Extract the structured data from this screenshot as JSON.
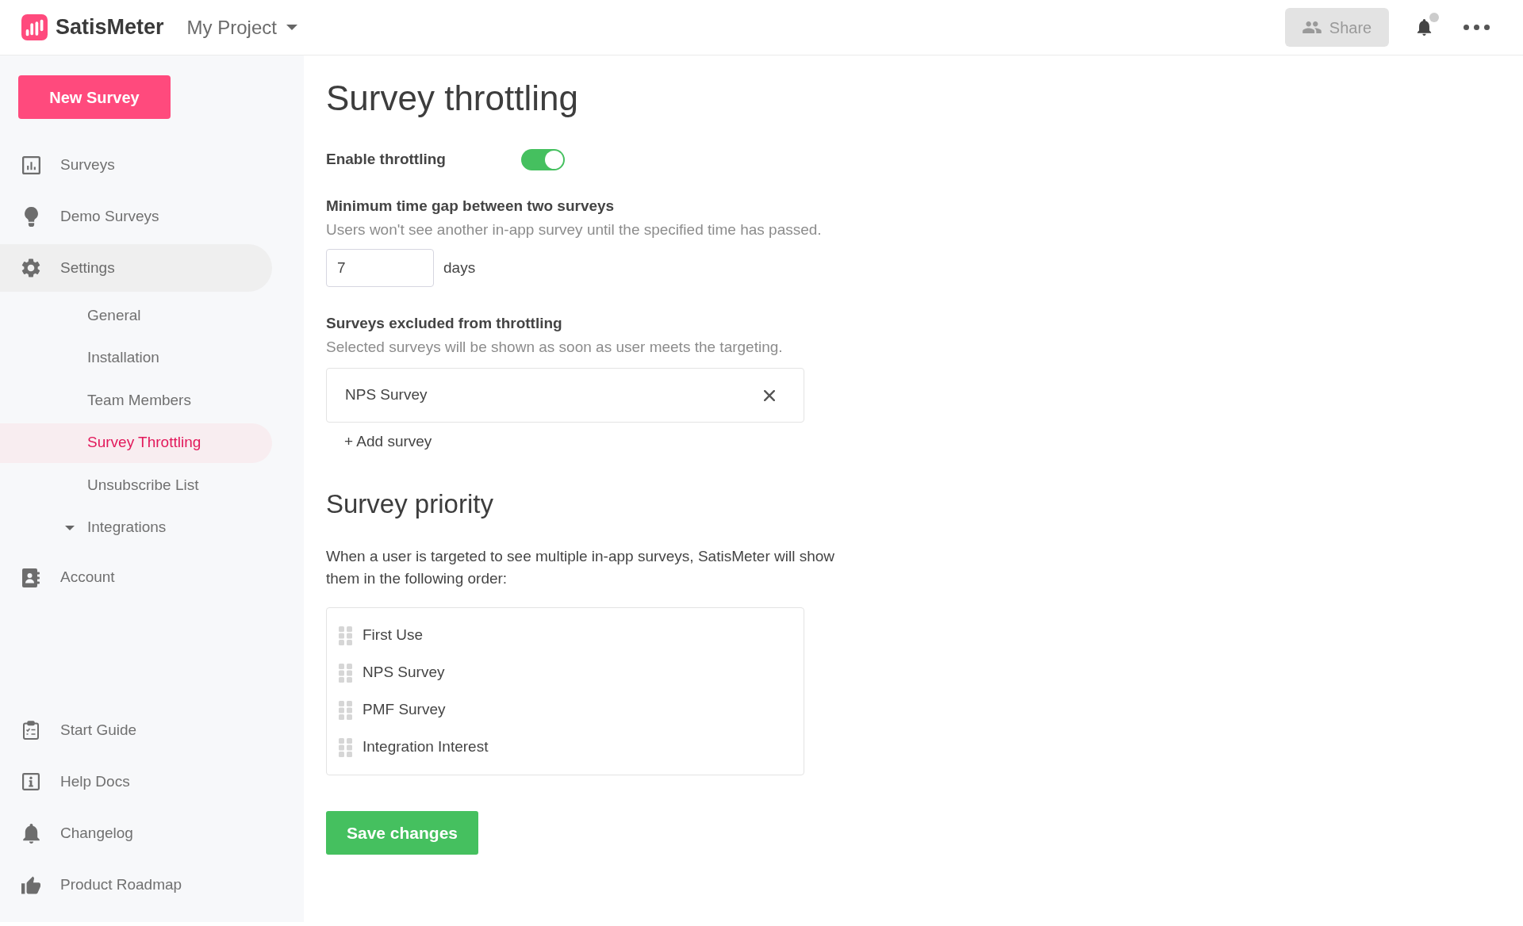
{
  "header": {
    "logo_text": "SatisMeter",
    "project": "My Project",
    "share_button": "Share",
    "has_unread_notifications": true
  },
  "sidebar": {
    "new_survey_button": "New Survey",
    "nav": [
      {
        "label": "Surveys",
        "selected": false
      },
      {
        "label": "Demo Surveys",
        "selected": false
      },
      {
        "label": "Settings",
        "selected": true,
        "children": [
          {
            "label": "General",
            "kind": "link",
            "selected": false
          },
          {
            "label": "Installation",
            "kind": "link",
            "selected": false
          },
          {
            "label": "Team Members",
            "kind": "link",
            "selected": false
          },
          {
            "label": "Survey Throttling",
            "kind": "link",
            "selected": true
          },
          {
            "label": "Unsubscribe List",
            "kind": "link",
            "selected": false
          },
          {
            "label": "Integrations",
            "kind": "group",
            "selected": false
          }
        ]
      },
      {
        "label": "Account",
        "selected": false
      }
    ],
    "footer_nav": [
      {
        "label": "Start Guide",
        "selected": false
      },
      {
        "label": "Help Docs",
        "selected": false
      },
      {
        "label": "Changelog",
        "selected": false
      },
      {
        "label": "Product Roadmap",
        "selected": false
      }
    ]
  },
  "page": {
    "title": "Survey throttling",
    "enable_throttling": {
      "label": "Enable throttling",
      "on": true
    },
    "min_gap": {
      "label": "Minimum time gap between two surveys",
      "description": "Users won't see another in-app survey until the specified time has passed.",
      "value": "7",
      "unit": "days"
    },
    "excluded": {
      "label": "Surveys excluded from throttling",
      "description": "Selected surveys will be shown as soon as user meets the targeting.",
      "surveys": [
        "NPS Survey"
      ],
      "add_link": "+ Add survey"
    },
    "priority": {
      "title": "Survey priority",
      "description": "When a user is targeted to see multiple in-app surveys, SatisMeter will show them in the following order:",
      "surveys": [
        "First Use",
        "NPS Survey",
        "PMF Survey",
        "Integration Interest"
      ]
    },
    "save_button": "Save changes"
  }
}
